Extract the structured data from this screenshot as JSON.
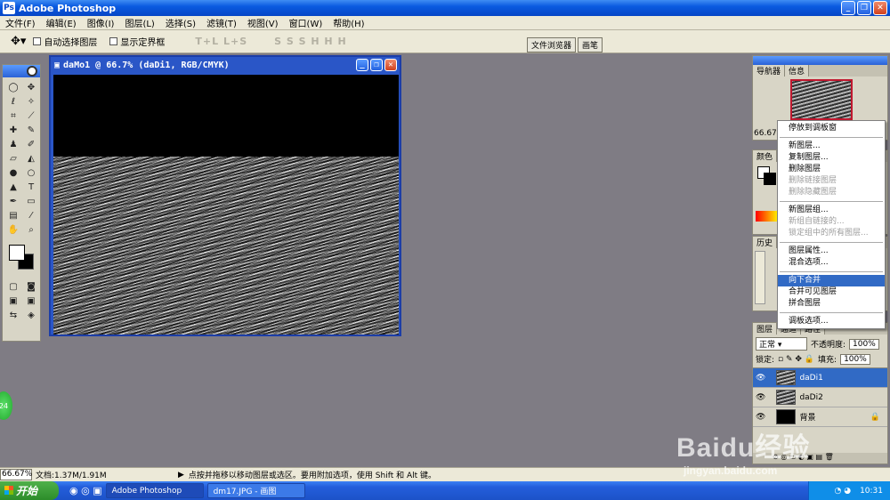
{
  "app": {
    "title": "Adobe Photoshop"
  },
  "menu": [
    "文件(F)",
    "编辑(E)",
    "图像(I)",
    "图层(L)",
    "选择(S)",
    "滤镜(T)",
    "视图(V)",
    "窗口(W)",
    "帮助(H)"
  ],
  "options": {
    "auto_select": "自动选择图层",
    "show_bounds": "显示定界框",
    "align_ghost1": "T+L  L+S",
    "align_ghost2": "S S S  H H H"
  },
  "well": {
    "file_browser": "文件浏览器",
    "brushes": "画笔"
  },
  "document": {
    "title": "daMo1 @ 66.7% (daDi1, RGB/CMYK)"
  },
  "navigator": {
    "tabs": [
      "导航器",
      "信息"
    ],
    "zoom": "66.67"
  },
  "color_panel": {
    "tabs": [
      "颜色"
    ]
  },
  "history_panel": {
    "tabs": [
      "历史"
    ]
  },
  "layers_panel": {
    "tabs": [
      "图层",
      "通道",
      "路径"
    ],
    "blend_mode": "正常",
    "opacity_label": "不透明度:",
    "opacity": "100%",
    "lock_label": "锁定:",
    "fill_label": "填充:",
    "fill": "100%",
    "layers": [
      {
        "name": "daDi1",
        "selected": true
      },
      {
        "name": "daDi2",
        "selected": false
      },
      {
        "name": "背景",
        "selected": false
      }
    ]
  },
  "context_menu": [
    {
      "label": "停放到调板窗",
      "disabled": false
    },
    {
      "sep": true
    },
    {
      "label": "新图层...",
      "disabled": false
    },
    {
      "label": "复制图层...",
      "disabled": false
    },
    {
      "label": "删除图层",
      "disabled": false
    },
    {
      "label": "删除链接图层",
      "disabled": true
    },
    {
      "label": "删除隐藏图层",
      "disabled": true
    },
    {
      "sep": true
    },
    {
      "label": "新图层组...",
      "disabled": false
    },
    {
      "label": "新组自链接的...",
      "disabled": true
    },
    {
      "label": "锁定组中的所有图层...",
      "disabled": true
    },
    {
      "sep": true
    },
    {
      "label": "图层属性...",
      "disabled": false
    },
    {
      "label": "混合选项...",
      "disabled": false
    },
    {
      "sep": true
    },
    {
      "label": "向下合并",
      "disabled": false,
      "highlight": true
    },
    {
      "label": "合并可见图层",
      "disabled": false
    },
    {
      "label": "拼合图层",
      "disabled": false
    },
    {
      "sep": true
    },
    {
      "label": "调板选项...",
      "disabled": false
    }
  ],
  "status": {
    "zoom": "66.67%",
    "doc": "文档:1.37M/1.91M",
    "hint": "点按并拖移以移动图层或选区。要用附加选项，使用 Shift 和 Alt 键。"
  },
  "taskbar": {
    "start": "开始",
    "tasks": [
      "Adobe Photoshop",
      "dm17.JPG - 画图"
    ],
    "clock": "10:31"
  },
  "badge": "24",
  "watermark": {
    "big": "Baidu经验",
    "small": "jingyan.baidu.com"
  }
}
